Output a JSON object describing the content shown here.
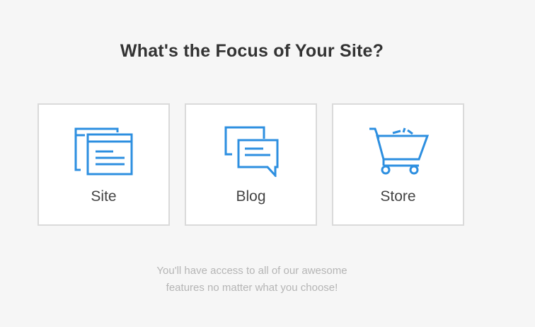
{
  "page": {
    "title": "What's the Focus of Your Site?",
    "accent_color": "#2d8fe0"
  },
  "options": [
    {
      "label": "Site",
      "icon": "site-icon"
    },
    {
      "label": "Blog",
      "icon": "blog-icon"
    },
    {
      "label": "Store",
      "icon": "store-icon"
    }
  ],
  "footer_note": {
    "line1": "You'll have access to all of our awesome",
    "line2": "features no matter what you choose!"
  }
}
